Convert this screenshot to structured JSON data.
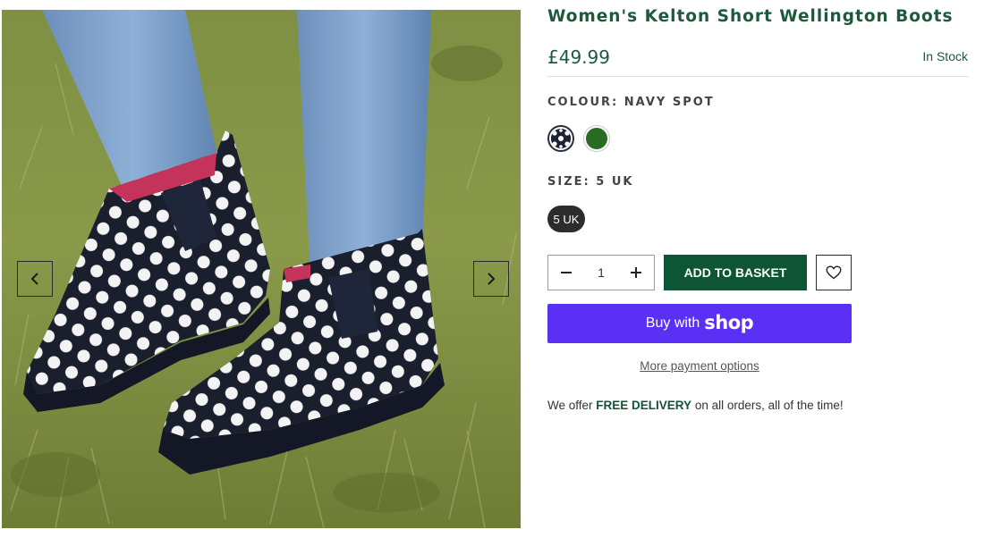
{
  "gallery": {
    "image_description_icon": "product-photo-navy-spot-boots",
    "prev_icon": "chevron-left-icon",
    "next_icon": "chevron-right-icon"
  },
  "product": {
    "title": "Women's Kelton Short Wellington Boots",
    "price": "£49.99",
    "stock_status": "In Stock"
  },
  "colour": {
    "label": "COLOUR:",
    "selected_value": "NAVY SPOT",
    "swatches": [
      {
        "name": "Navy Spot",
        "color": "#1c2235",
        "selected": true
      },
      {
        "name": "Green",
        "color": "#2b6b24",
        "selected": false
      }
    ]
  },
  "size": {
    "label": "SIZE:",
    "selected_value": "5 UK",
    "options": [
      "5 UK"
    ]
  },
  "purchase": {
    "quantity": "1",
    "add_to_basket_label": "ADD TO BASKET",
    "buy_with_label": "Buy with",
    "shop_logo": "shop",
    "more_payment_options": "More payment options"
  },
  "delivery": {
    "prefix": "We offer ",
    "highlight": "FREE DELIVERY",
    "suffix": " on all orders, all of the time!"
  },
  "colors": {
    "brand_green": "#1d5a3b",
    "button_green": "#0e5535",
    "shop_purple": "#5a31f4"
  }
}
